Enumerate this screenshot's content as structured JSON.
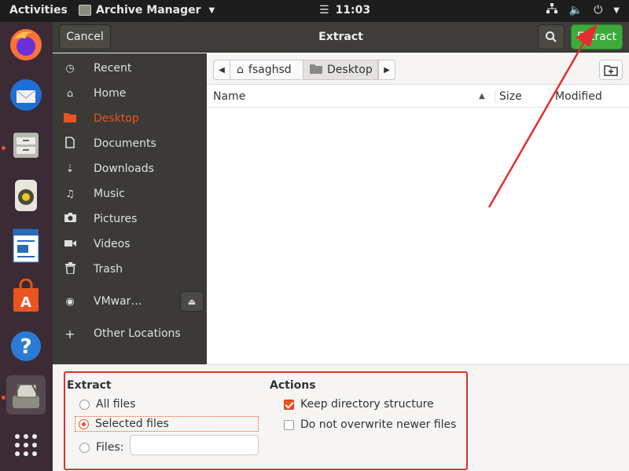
{
  "topbar": {
    "activities": "Activities",
    "app_name": "Archive Manager",
    "clock": "11:03"
  },
  "dock": {
    "items": [
      "firefox",
      "thunderbird",
      "file-manager",
      "rhythmbox",
      "libreoffice-writer",
      "software-center",
      "help",
      "archive-manager",
      "show-apps"
    ]
  },
  "header": {
    "cancel": "Cancel",
    "title": "Extract",
    "extract": "Extract"
  },
  "sidebar": {
    "items": [
      {
        "label": "Recent",
        "icon": "clock-icon"
      },
      {
        "label": "Home",
        "icon": "home-icon"
      },
      {
        "label": "Desktop",
        "icon": "folder-icon"
      },
      {
        "label": "Documents",
        "icon": "document-icon"
      },
      {
        "label": "Downloads",
        "icon": "download-icon"
      },
      {
        "label": "Music",
        "icon": "music-icon"
      },
      {
        "label": "Pictures",
        "icon": "camera-icon"
      },
      {
        "label": "Videos",
        "icon": "video-icon"
      },
      {
        "label": "Trash",
        "icon": "trash-icon"
      },
      {
        "label": "VMwar…",
        "icon": "disc-icon"
      },
      {
        "label": "Other Locations",
        "icon": "plus-icon"
      }
    ],
    "selected": "Desktop"
  },
  "pathbar": {
    "home": "fsaghsd",
    "current": "Desktop"
  },
  "columns": {
    "name": "Name",
    "size": "Size",
    "modified": "Modified"
  },
  "options": {
    "extract_title": "Extract",
    "all_files": "All files",
    "selected_files": "Selected files",
    "files": "Files:",
    "files_value": "",
    "selected_mode": "Selected files",
    "actions_title": "Actions",
    "keep_structure": "Keep directory structure",
    "keep_structure_checked": true,
    "no_overwrite": "Do not overwrite newer files",
    "no_overwrite_checked": false
  },
  "colors": {
    "accent": "#e95420",
    "extract_button": "#3daa3c",
    "annotation": "#e52d2d"
  }
}
